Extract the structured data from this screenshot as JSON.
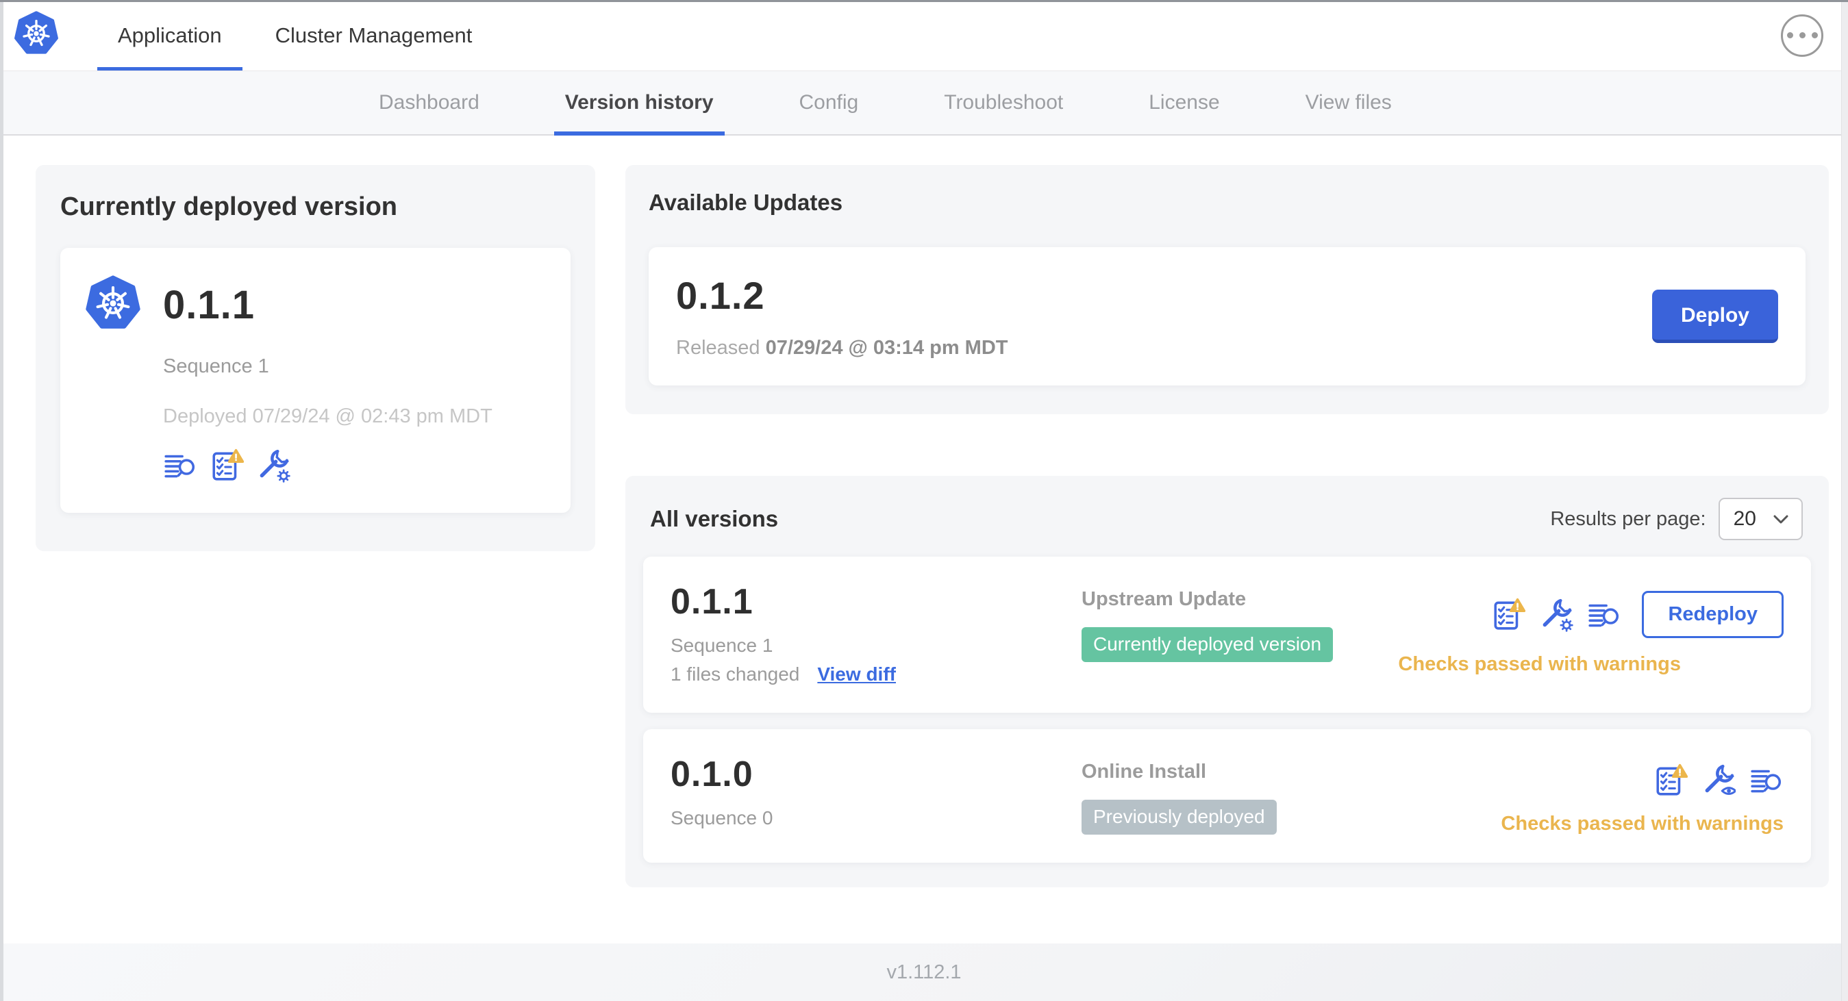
{
  "header": {
    "logo_icon": "kubernetes-logo",
    "tabs": [
      {
        "label": "Application",
        "active": true
      },
      {
        "label": "Cluster Management",
        "active": false
      }
    ],
    "overflow_icon": "ellipsis-icon"
  },
  "subnav": {
    "tabs": [
      "Dashboard",
      "Version history",
      "Config",
      "Troubleshoot",
      "License",
      "View files"
    ],
    "active_tab": "Version history"
  },
  "current_version": {
    "title": "Currently deployed version",
    "version": "0.1.1",
    "sequence": "Sequence 1",
    "deployed": "Deployed 07/29/24 @ 02:43 pm MDT",
    "icons": [
      "release-notes-icon",
      "preflight-checks-warning-icon",
      "edit-config-icon"
    ]
  },
  "available_updates": {
    "title": "Available Updates",
    "version": "0.1.2",
    "released_prefix": "Released",
    "released_date": "07/29/24 @ 03:14 pm MDT",
    "deploy_label": "Deploy"
  },
  "all_versions": {
    "title": "All versions",
    "results_per_page_label": "Results per page:",
    "results_per_page_value": "20",
    "rows": [
      {
        "version": "0.1.1",
        "sequence": "Sequence 1",
        "files_changed": "1 files changed",
        "view_diff_label": "View diff",
        "source": "Upstream Update",
        "badge": "Currently deployed version",
        "badge_color": "#65c4a1",
        "status": "Checks passed with warnings",
        "action_label": "Redeploy",
        "icons": [
          "preflight-checks-warning-icon",
          "edit-config-icon",
          "release-notes-icon"
        ]
      },
      {
        "version": "0.1.0",
        "sequence": "Sequence 0",
        "source": "Online Install",
        "badge": "Previously deployed",
        "badge_color": "#b6c1c7",
        "status": "Checks passed with warnings",
        "icons": [
          "preflight-checks-warning-icon",
          "view-config-icon",
          "release-notes-icon"
        ]
      }
    ]
  },
  "footer": {
    "app_manager_version": "v1.112.1"
  },
  "colors": {
    "accent_blue": "#3b6be0",
    "kubernetes_blue": "#3c6be0",
    "badge_green": "#65c4a1",
    "badge_gray": "#b6c1c7",
    "warning_amber": "#eab54e",
    "subnav_bg": "#f7f8fa",
    "card_bg": "#f5f6f8"
  }
}
